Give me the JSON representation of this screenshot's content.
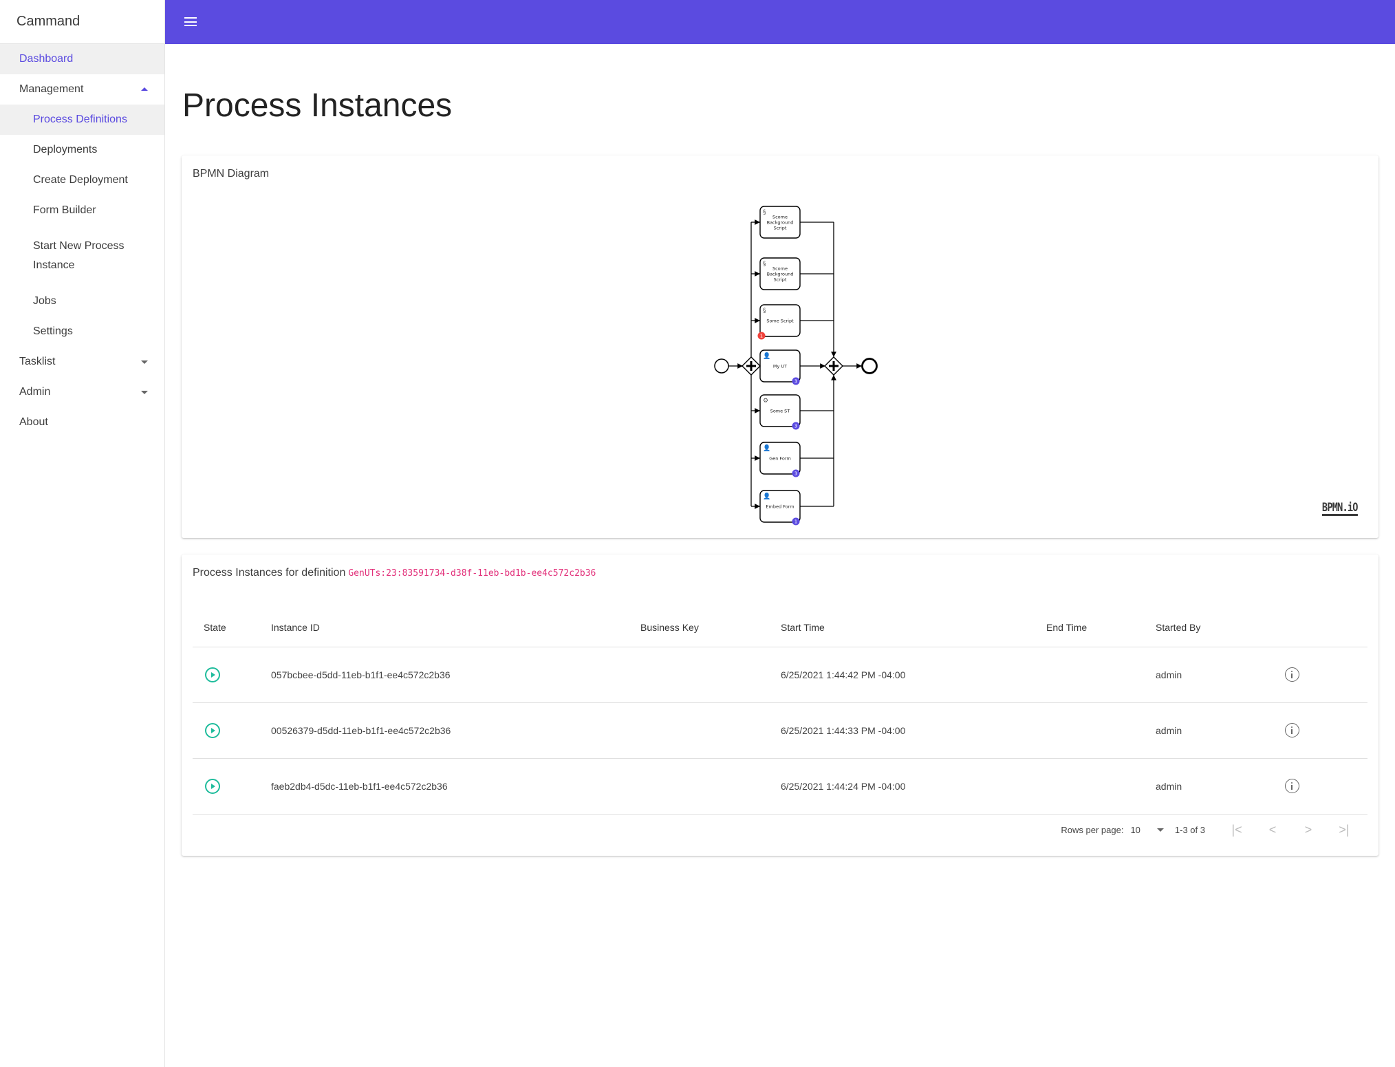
{
  "app": {
    "title": "Cammand",
    "accent_color": "#5b4be0"
  },
  "topbar": {
    "menu_icon": "hamburger-icon"
  },
  "sidebar": {
    "items": [
      {
        "label": "Dashboard",
        "level": 0,
        "active": true
      },
      {
        "label": "Management",
        "level": 0,
        "expandable": true,
        "expanded": true
      },
      {
        "label": "Process Definitions",
        "level": 1,
        "active": true
      },
      {
        "label": "Deployments",
        "level": 1
      },
      {
        "label": "Create Deployment",
        "level": 1
      },
      {
        "label": "Form Builder",
        "level": 1
      },
      {
        "label": "Start New Process Instance",
        "level": 1
      },
      {
        "label": "Jobs",
        "level": 1
      },
      {
        "label": "Settings",
        "level": 1
      },
      {
        "label": "Tasklist",
        "level": 0,
        "expandable": true,
        "expanded": false
      },
      {
        "label": "Admin",
        "level": 0,
        "expandable": true,
        "expanded": false
      },
      {
        "label": "About",
        "level": 0
      }
    ]
  },
  "page": {
    "title": "Process Instances"
  },
  "bpmn": {
    "title": "BPMN Diagram",
    "logo": "BPMN.iO",
    "tasks": [
      {
        "label": "Scome Background Script",
        "type": "script",
        "badge": null
      },
      {
        "label": "Scome Background Script",
        "type": "script",
        "badge": null
      },
      {
        "label": "Some Script",
        "type": "script",
        "badge": "1",
        "badge_color": "#f0413a",
        "badge_side": "left"
      },
      {
        "label": "My UT",
        "type": "user",
        "badge": "3",
        "badge_color": "#5b4be0",
        "badge_side": "right"
      },
      {
        "label": "Some ST",
        "type": "service",
        "badge": "3",
        "badge_color": "#5b4be0",
        "badge_side": "right"
      },
      {
        "label": "Gen Form",
        "type": "user",
        "badge": "3",
        "badge_color": "#5b4be0",
        "badge_side": "right"
      },
      {
        "label": "Embed Form",
        "type": "user",
        "badge": "1",
        "badge_color": "#5b4be0",
        "badge_side": "right"
      }
    ]
  },
  "instances": {
    "heading": "Process Instances for definition",
    "definition_id": "GenUTs:23:83591734-d38f-11eb-bd1b-ee4c572c2b36",
    "columns": [
      "State",
      "Instance ID",
      "Business Key",
      "Start Time",
      "End Time",
      "Started By",
      ""
    ],
    "rows": [
      {
        "state": "running",
        "id": "057bcbee-d5dd-11eb-b1f1-ee4c572c2b36",
        "business_key": "",
        "start": "6/25/2021 1:44:42 PM -04:00",
        "end": "",
        "by": "admin"
      },
      {
        "state": "running",
        "id": "00526379-d5dd-11eb-b1f1-ee4c572c2b36",
        "business_key": "",
        "start": "6/25/2021 1:44:33 PM -04:00",
        "end": "",
        "by": "admin"
      },
      {
        "state": "running",
        "id": "faeb2db4-d5dc-11eb-b1f1-ee4c572c2b36",
        "business_key": "",
        "start": "6/25/2021 1:44:24 PM -04:00",
        "end": "",
        "by": "admin"
      }
    ],
    "state_color": "#1fbc9c",
    "pagination": {
      "rows_per_page_label": "Rows per page:",
      "rows_per_page": "10",
      "range": "1-3 of 3",
      "first": "|<",
      "prev": "<",
      "next": ">",
      "last": ">|"
    }
  }
}
